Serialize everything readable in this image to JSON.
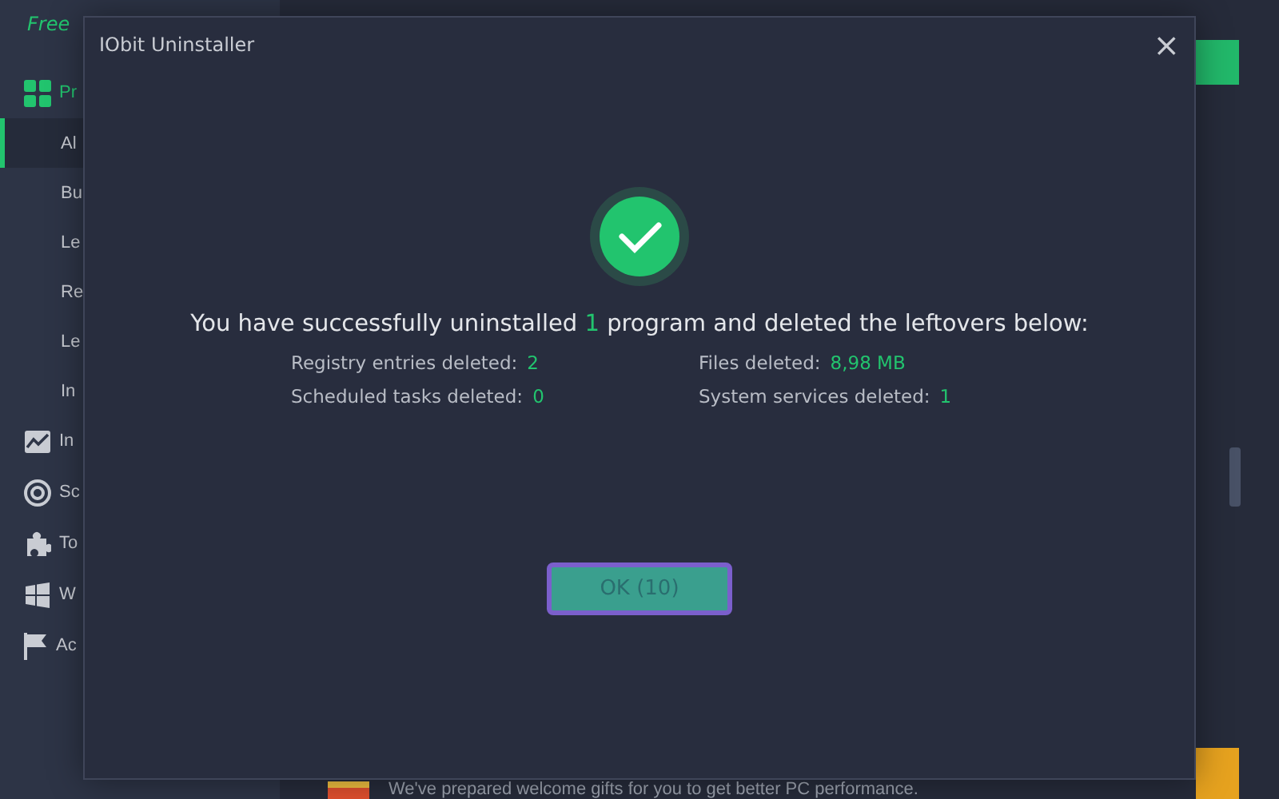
{
  "app": {
    "edition": "Free",
    "sidebar": [
      {
        "label": "Pr",
        "kind": "grid",
        "selected": true,
        "children": [
          {
            "label": "Al",
            "selected": true
          },
          {
            "label": "Bu",
            "selected": false
          },
          {
            "label": "Le",
            "selected": false
          },
          {
            "label": "Re",
            "selected": false
          },
          {
            "label": "Le",
            "selected": false
          },
          {
            "label": "In",
            "selected": false
          }
        ]
      },
      {
        "label": "In",
        "kind": "chart",
        "selected": false
      },
      {
        "label": "Sc",
        "kind": "target",
        "selected": false
      },
      {
        "label": "To",
        "kind": "puzzle",
        "selected": false
      },
      {
        "label": "W",
        "kind": "windows",
        "selected": false
      },
      {
        "label": "Ac",
        "kind": "flag",
        "selected": false
      }
    ],
    "banner": {
      "text": "We've prepared welcome gifts for you to get better PC performance."
    }
  },
  "dialog": {
    "title": "IObit Uninstaller",
    "close": "×",
    "headline": {
      "before": "You have successfully uninstalled ",
      "count": "1",
      "after": " program and deleted the leftovers below:"
    },
    "stats": [
      {
        "label": "Registry entries deleted:",
        "value": "2"
      },
      {
        "label": "Files deleted:",
        "value": "8,98 MB"
      },
      {
        "label": "Scheduled tasks deleted:",
        "value": "0"
      },
      {
        "label": "System services deleted:",
        "value": "1"
      }
    ],
    "button": "OK (10)"
  }
}
